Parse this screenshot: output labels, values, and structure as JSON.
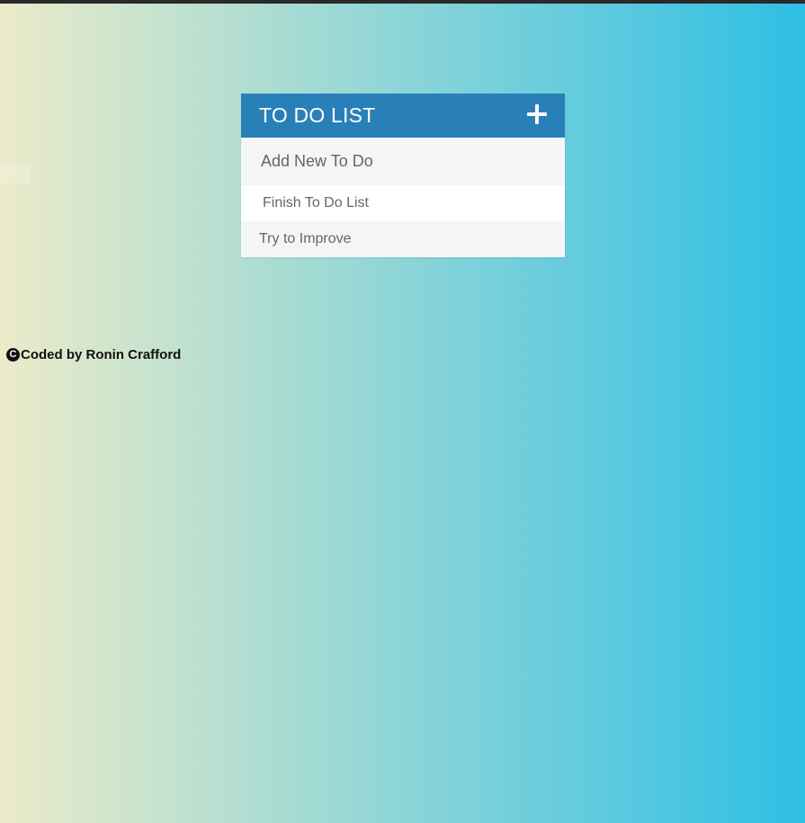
{
  "app": {
    "title": "TO DO LIST"
  },
  "header": {
    "add_icon": "plus-icon"
  },
  "input": {
    "placeholder": "Add New To Do",
    "value": ""
  },
  "todos": [
    {
      "text": "Finish To Do List"
    },
    {
      "text": "Try to Improve"
    }
  ],
  "footer": {
    "copyright_symbol": "C",
    "credit": "Coded by Ronin Crafford"
  },
  "colors": {
    "header": "#2980b9",
    "gradient_start": "#ebebc9",
    "gradient_end": "#2ebfe5",
    "item_alt": "#f5f5f5"
  }
}
